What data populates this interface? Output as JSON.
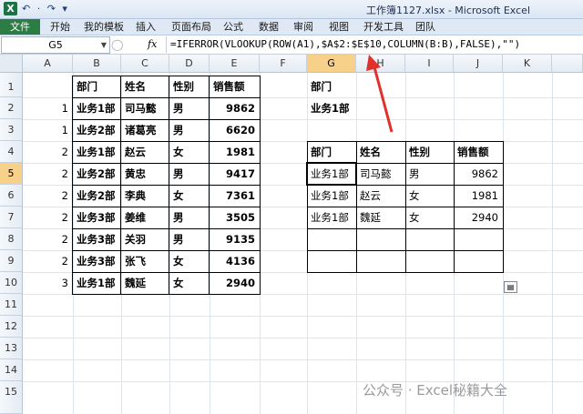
{
  "window": {
    "title": "工作簿1127.xlsx - Microsoft Excel",
    "app_icon": "X"
  },
  "quick_access": "↶ · ↷ ▾",
  "ribbon": {
    "tabs": [
      "文件",
      "开始",
      "我的模板",
      "插入",
      "页面布局",
      "公式",
      "数据",
      "审阅",
      "视图",
      "开发工具",
      "团队"
    ]
  },
  "formula_bar": {
    "name_box": "G5",
    "fx": "fx",
    "formula": "=IFERROR(VLOOKUP(ROW(A1),$A$2:$E$10,COLUMN(B:B),FALSE),\"\")"
  },
  "columns": [
    "A",
    "B",
    "C",
    "D",
    "E",
    "F",
    "G",
    "H",
    "I",
    "J",
    "K"
  ],
  "rows": [
    "1",
    "2",
    "3",
    "4",
    "5",
    "6",
    "7",
    "8",
    "9",
    "10",
    "11",
    "12",
    "13",
    "14",
    "15"
  ],
  "source_table": {
    "headers": [
      "部门",
      "姓名",
      "性别",
      "销售额"
    ],
    "rows": [
      {
        "a": "1",
        "dept": "业务1部",
        "name": "司马懿",
        "sex": "男",
        "sales": "9862"
      },
      {
        "a": "1",
        "dept": "业务2部",
        "name": "诸葛亮",
        "sex": "男",
        "sales": "6620"
      },
      {
        "a": "2",
        "dept": "业务1部",
        "name": "赵云",
        "sex": "女",
        "sales": "1981"
      },
      {
        "a": "2",
        "dept": "业务2部",
        "name": "黄忠",
        "sex": "男",
        "sales": "9417"
      },
      {
        "a": "2",
        "dept": "业务2部",
        "name": "李典",
        "sex": "女",
        "sales": "7361"
      },
      {
        "a": "2",
        "dept": "业务3部",
        "name": "姜维",
        "sex": "男",
        "sales": "3505"
      },
      {
        "a": "2",
        "dept": "业务3部",
        "name": "关羽",
        "sex": "男",
        "sales": "9135"
      },
      {
        "a": "2",
        "dept": "业务3部",
        "name": "张飞",
        "sex": "女",
        "sales": "4136"
      },
      {
        "a": "3",
        "dept": "业务1部",
        "name": "魏延",
        "sex": "女",
        "sales": "2940"
      }
    ]
  },
  "criteria": {
    "label": "部门",
    "value": "业务1部"
  },
  "result_table": {
    "headers": [
      "部门",
      "姓名",
      "性别",
      "销售额"
    ],
    "rows": [
      {
        "dept": "业务1部",
        "name": "司马懿",
        "sex": "男",
        "sales": "9862"
      },
      {
        "dept": "业务1部",
        "name": "赵云",
        "sex": "女",
        "sales": "1981"
      },
      {
        "dept": "业务1部",
        "name": "魏延",
        "sex": "女",
        "sales": "2940"
      }
    ]
  },
  "watermark": "公众号 · Excel秘籍大全",
  "colors": {
    "excel_green": "#1e7145",
    "selected_header": "#f7d18a",
    "arrow": "#e0312b"
  }
}
